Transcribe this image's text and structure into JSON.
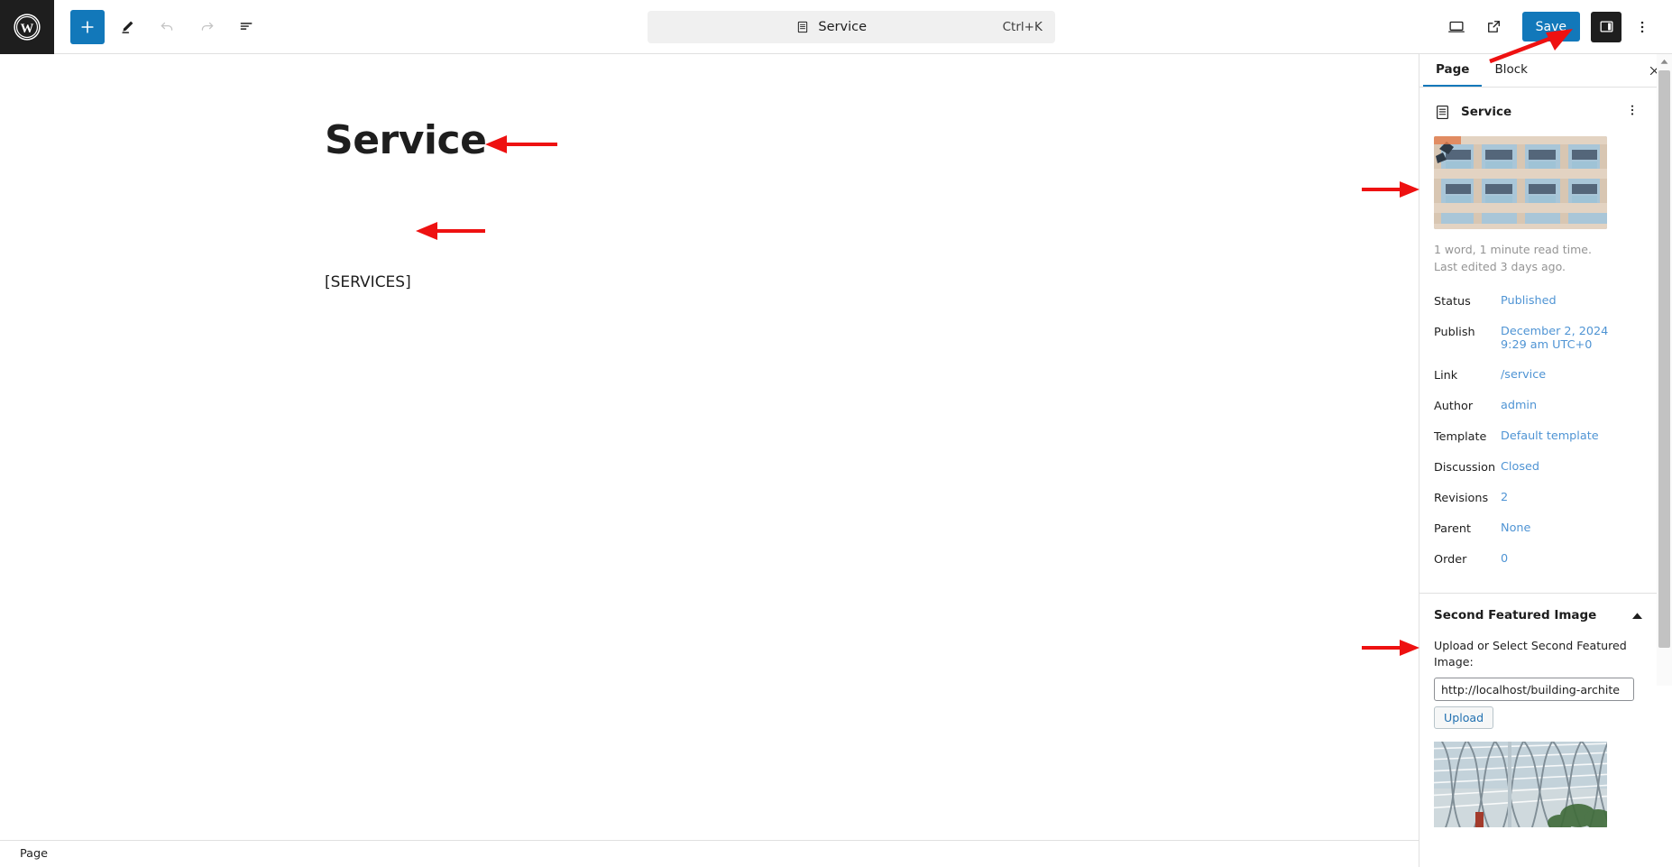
{
  "app": {
    "name": "WordPress Block Editor",
    "logo_icon": "wordpress-logo-icon"
  },
  "toolbar": {
    "add_block_icon": "plus-icon",
    "tools_icon": "pencil-icon",
    "undo_icon": "undo-arrow-icon",
    "redo_icon": "redo-arrow-icon",
    "document_overview_icon": "list-view-icon",
    "view_icon": "desktop-preview-icon",
    "external_link_icon": "external-link-icon",
    "save_label": "Save",
    "sidebar_toggle_icon": "settings-sidebar-icon",
    "options_icon": "vertical-dots-icon"
  },
  "command_bar": {
    "icon": "page-document-icon",
    "title": "Service",
    "shortcut": "Ctrl+K"
  },
  "editor": {
    "title": "Service",
    "paragraph": "[SERVICES]"
  },
  "sidebar": {
    "tabs": [
      {
        "label": "Page",
        "active": true
      },
      {
        "label": "Block",
        "active": false
      }
    ],
    "close_icon": "close-icon",
    "document": {
      "icon": "page-document-icon",
      "label": "Service",
      "menu_icon": "vertical-dots-icon"
    },
    "featured_image_alt": "building facade with balconies",
    "meta": {
      "word_count": "1 word, 1 minute read time.",
      "last_edited": "Last edited 3 days ago."
    },
    "fields": [
      {
        "key": "Status",
        "value": "Published"
      },
      {
        "key": "Publish",
        "value": "December 2, 2024\n9:29 am UTC+0"
      },
      {
        "key": "Link",
        "value": "/service"
      },
      {
        "key": "Author",
        "value": "admin"
      },
      {
        "key": "Template",
        "value": "Default template"
      },
      {
        "key": "Discussion",
        "value": "Closed"
      },
      {
        "key": "Revisions",
        "value": "2"
      },
      {
        "key": "Parent",
        "value": "None"
      },
      {
        "key": "Order",
        "value": "0"
      }
    ],
    "second_featured_image": {
      "title": "Second Featured Image",
      "collapse_icon": "caret-up-icon",
      "hint": "Upload or Select Second Featured Image:",
      "url_value": "http://localhost/building-archite",
      "upload_label": "Upload",
      "preview_alt": "glass lattice roof structure"
    }
  },
  "status_bar": {
    "label": "Page"
  },
  "colors": {
    "accent": "#1278ba",
    "link": "#4f94d4",
    "annotation": "#ee1111",
    "dark": "#1e1e1e"
  },
  "annotations": [
    {
      "name": "arrow-to-page-title",
      "points_to": "Service title"
    },
    {
      "name": "arrow-to-services-shortcode",
      "points_to": "[SERVICES]"
    },
    {
      "name": "arrow-to-save-button",
      "points_to": "Save"
    },
    {
      "name": "arrow-to-featured-image",
      "points_to": "featured image"
    },
    {
      "name": "arrow-to-second-featured-image",
      "points_to": "Second Featured Image"
    }
  ]
}
